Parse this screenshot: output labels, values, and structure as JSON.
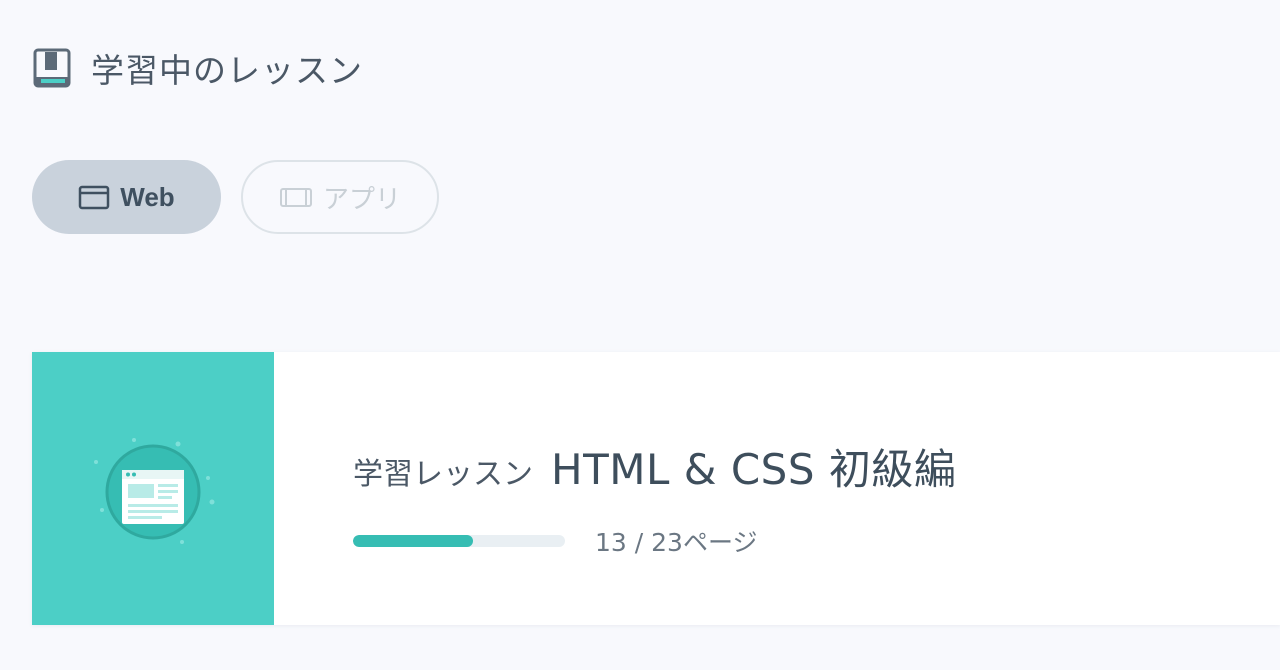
{
  "section": {
    "title": "学習中のレッスン",
    "icon": "book-icon"
  },
  "tabs": [
    {
      "label": "Web",
      "icon": "browser-window-icon",
      "selected": true
    },
    {
      "label": "アプリ",
      "icon": "mobile-device-icon",
      "selected": false
    }
  ],
  "lesson": {
    "prefix": "学習レッスン",
    "title": "HTML & CSS 初級編",
    "progress": {
      "current": 13,
      "total": 23,
      "label": "13 / 23ページ"
    },
    "thumbnail_icon": "web-page-illustration-icon"
  },
  "colors": {
    "background": "#f8f9fd",
    "accent": "#36bdb3",
    "thumbnail_bg": "#4ccfc6",
    "tab_selected_bg": "#c9d2dc",
    "progress_track": "#e9eff3"
  }
}
